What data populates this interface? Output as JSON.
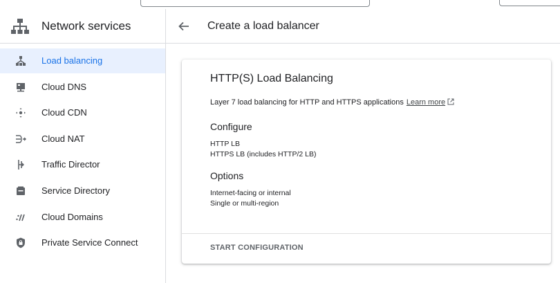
{
  "sidebar": {
    "title": "Network services",
    "items": [
      {
        "label": "Load balancing",
        "icon": "load-balancing-icon",
        "active": true
      },
      {
        "label": "Cloud DNS",
        "icon": "cloud-dns-icon",
        "active": false
      },
      {
        "label": "Cloud CDN",
        "icon": "cloud-cdn-icon",
        "active": false
      },
      {
        "label": "Cloud NAT",
        "icon": "cloud-nat-icon",
        "active": false
      },
      {
        "label": "Traffic Director",
        "icon": "traffic-director-icon",
        "active": false
      },
      {
        "label": "Service Directory",
        "icon": "service-directory-icon",
        "active": false
      },
      {
        "label": "Cloud Domains",
        "icon": "cloud-domains-icon",
        "active": false
      },
      {
        "label": "Private Service Connect",
        "icon": "private-service-connect-icon",
        "active": false
      }
    ]
  },
  "header": {
    "title": "Create a load balancer"
  },
  "card": {
    "title": "HTTP(S) Load Balancing",
    "description": "Layer 7 load balancing for HTTP and HTTPS applications",
    "learn_more": "Learn more",
    "configure_title": "Configure",
    "configure_items": [
      "HTTP LB",
      "HTTPS LB (includes HTTP/2 LB)"
    ],
    "options_title": "Options",
    "options_items": [
      "Internet-facing or internal",
      "Single or multi-region"
    ],
    "action_label": "START CONFIGURATION"
  },
  "colors": {
    "accent": "#1a73e8",
    "active_bg": "#e8f0fe",
    "icon_gray": "#5f6368",
    "border": "#dadce0"
  }
}
